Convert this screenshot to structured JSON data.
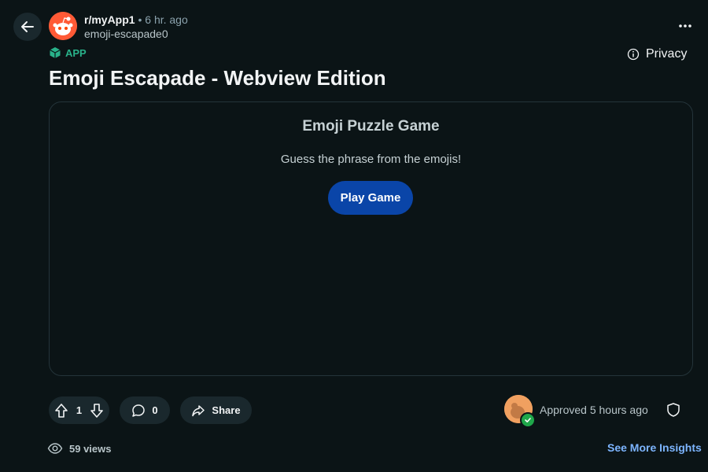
{
  "header": {
    "subreddit": "r/myApp1",
    "separator": "•",
    "time": "6 hr. ago",
    "author": "emoji-escapade0",
    "app_badge": "APP",
    "privacy": "Privacy"
  },
  "post": {
    "title": "Emoji Escapade - Webview Edition"
  },
  "webview": {
    "game_title": "Emoji Puzzle Game",
    "subtitle": "Guess the phrase from the emojis!",
    "play_button": "Play Game"
  },
  "actions": {
    "vote_count": "1",
    "comment_count": "0",
    "share_label": "Share",
    "approved_text": "Approved 5 hours ago"
  },
  "footer": {
    "views": "59 views",
    "insights_link": "See More Insights"
  },
  "colors": {
    "background": "#0b1416",
    "accent_button": "#0a45a8",
    "app_badge": "#29b28a",
    "link": "#7db5ff",
    "approved_check": "#1fa74a"
  },
  "icons": [
    "back-arrow-icon",
    "snoo-avatar-icon",
    "more-icon",
    "app-cube-icon",
    "info-icon",
    "upvote-icon",
    "downvote-icon",
    "comment-icon",
    "share-icon",
    "shield-icon",
    "views-icon"
  ]
}
